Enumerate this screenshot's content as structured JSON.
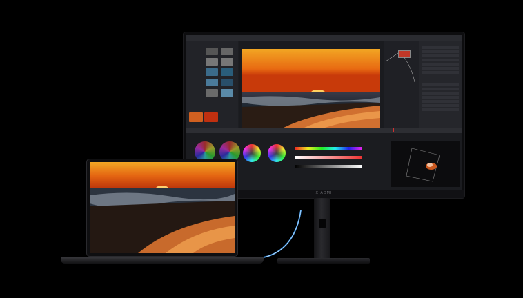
{
  "scene": {
    "description_free": true,
    "monitor_brand": "XIAOMI",
    "colors": {
      "background": "#000000",
      "sky_top": "#f0a020",
      "sky_mid": "#e06010",
      "sun": "#ffd060",
      "sea": "#2b3a4a",
      "sand": "#d08040",
      "cable_glow": "#4aa8ff"
    }
  }
}
